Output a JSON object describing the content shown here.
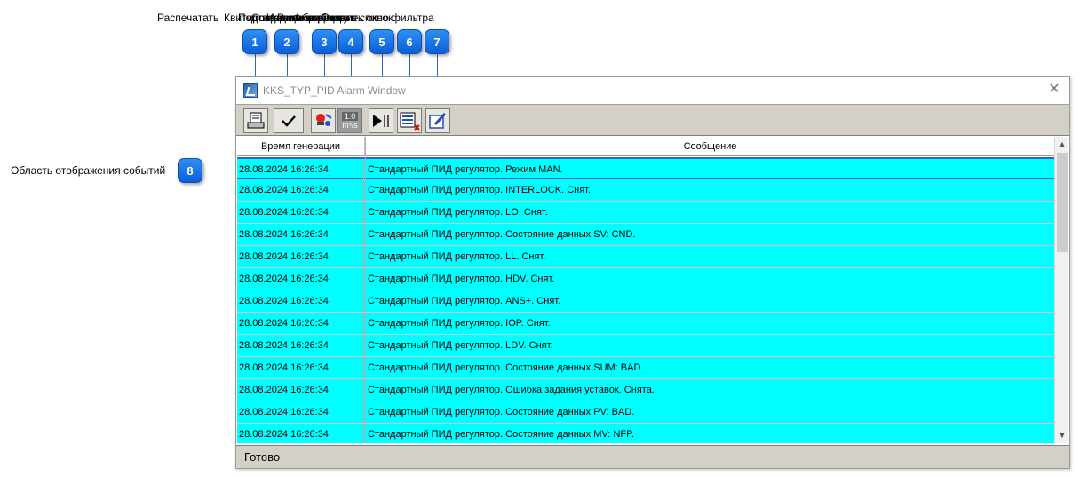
{
  "top_labels": [
    "Распечатать",
    "Квитировать выбранные",
    "Подтвердить все",
    "Сохранить выборку",
    "Изменить режим",
    "Фиксировать список",
    "Открыть окно фильтра",
    "Редактирование"
  ],
  "side_label": "Область отображения событий",
  "callouts": [
    "1",
    "2",
    "3",
    "4",
    "5",
    "6",
    "7",
    "8"
  ],
  "window": {
    "title": "KKS_TYP_PID Alarm Window",
    "close_icon": "close-icon"
  },
  "toolbar": {
    "buttons": [
      "print-icon",
      "check-icon",
      "alarm-filter-icon",
      "units-icon",
      "play-pause-icon",
      "list-delete-icon",
      "edit-icon"
    ],
    "units_top": "1.0",
    "units_bottom": "m³/s"
  },
  "table": {
    "headers": [
      "Время генерации",
      "Сообщение"
    ],
    "rows": [
      {
        "time": "28.08.2024 16:26:34",
        "msg": "Стандартный ПИД регулятор. Режим MAN."
      },
      {
        "time": "28.08.2024 16:26:34",
        "msg": "Стандартный ПИД регулятор. INTERLOCK. Снят."
      },
      {
        "time": "28.08.2024 16:26:34",
        "msg": "Стандартный ПИД регулятор. LO. Снят."
      },
      {
        "time": "28.08.2024 16:26:34",
        "msg": "Стандартный ПИД регулятор. Состояние данных SV: CND."
      },
      {
        "time": "28.08.2024 16:26:34",
        "msg": "Стандартный ПИД регулятор. LL. Снят."
      },
      {
        "time": "28.08.2024 16:26:34",
        "msg": "Стандартный ПИД регулятор. HDV. Снят."
      },
      {
        "time": "28.08.2024 16:26:34",
        "msg": "Стандартный ПИД регулятор. ANS+. Снят."
      },
      {
        "time": "28.08.2024 16:26:34",
        "msg": "Стандартный ПИД регулятор. IOP. Снят."
      },
      {
        "time": "28.08.2024 16:26:34",
        "msg": "Стандартный ПИД регулятор. LDV. Снят."
      },
      {
        "time": "28.08.2024 16:26:34",
        "msg": "Стандартный ПИД регулятор. Состояние данных SUM: BAD."
      },
      {
        "time": "28.08.2024 16:26:34",
        "msg": "Стандартный ПИД регулятор. Ошибка задания уставок. Снята."
      },
      {
        "time": "28.08.2024 16:26:34",
        "msg": "Стандартный ПИД регулятор. Состояние данных PV: BAD."
      },
      {
        "time": "28.08.2024 16:26:34",
        "msg": "Стандартный ПИД регулятор. Состояние данных MV: NFP."
      }
    ]
  },
  "status": "Готово",
  "colors": {
    "row_bg": "#00ffff",
    "callout": "#0a5fd8",
    "toolbar_bg": "#d4d0c8"
  }
}
